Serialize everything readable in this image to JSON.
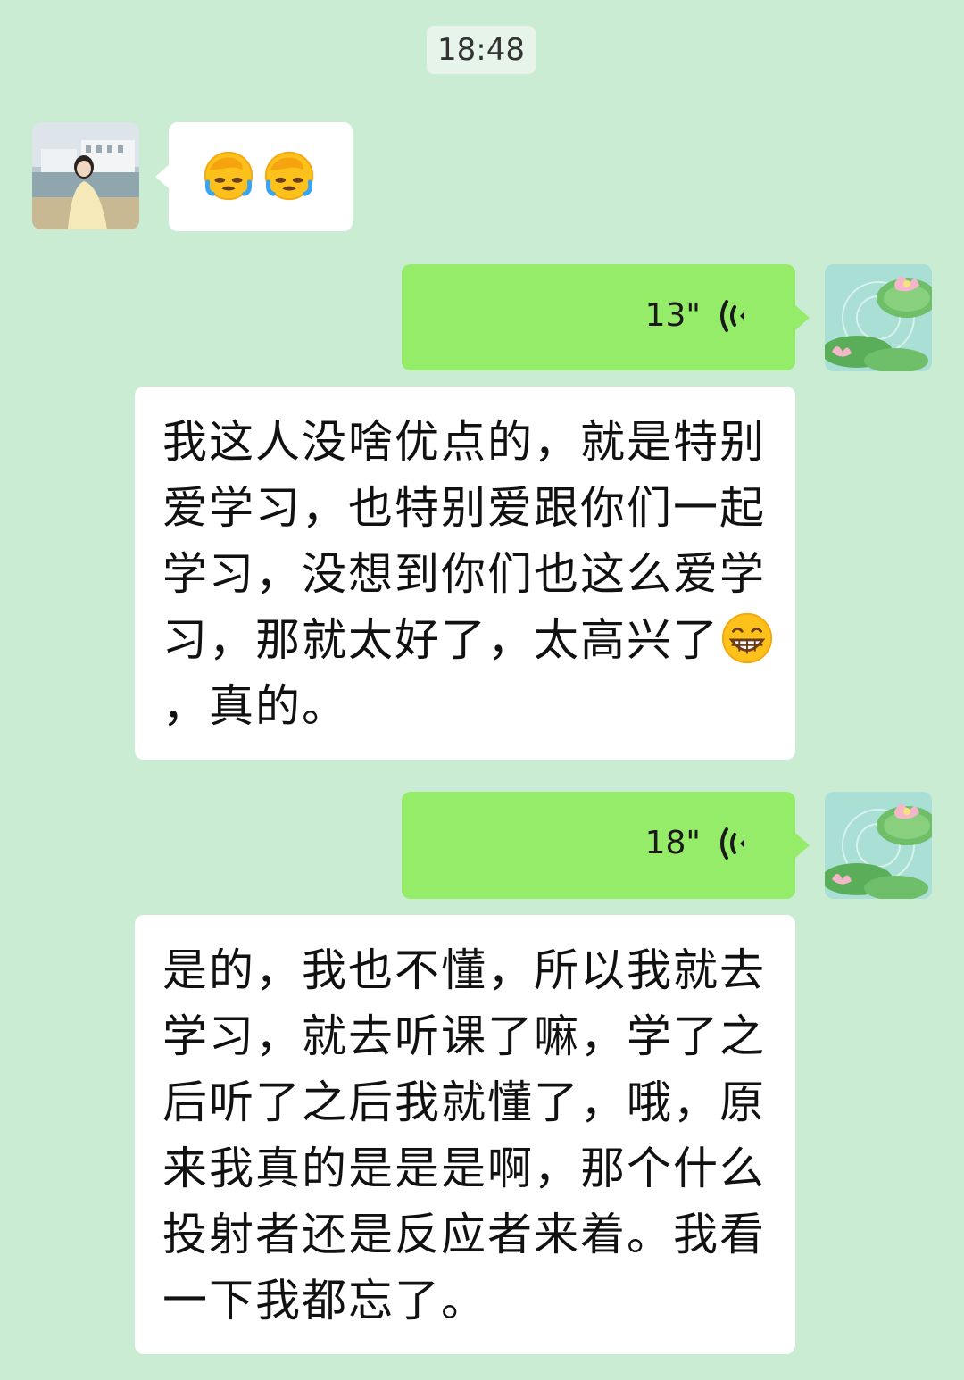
{
  "chat": {
    "timestamp": "18:48",
    "messages": [
      {
        "sender": "other",
        "type": "emoji",
        "emoji": [
          "face-palm-crying-emoji",
          "face-palm-crying-emoji"
        ]
      },
      {
        "sender": "self",
        "type": "voice",
        "duration": "13\""
      },
      {
        "sender": "self",
        "type": "text",
        "text_before": "我这人没啥优点的，就是特别爱学习，也特别爱跟你们一起学习，没想到你们也这么爱学习，那就太好了，太高兴了",
        "emoji": "grin-emoji",
        "text_after": "，真的。"
      },
      {
        "sender": "self",
        "type": "voice",
        "duration": "18\""
      },
      {
        "sender": "self",
        "type": "text",
        "text": "是的，我也不懂，所以我就去学习，就去听课了嘛，学了之后听了之后我就懂了，哦，原来我真的是是是啊，那个什么投射者还是反应者来着。我看一下我都忘了。"
      }
    ]
  },
  "colors": {
    "background": "#c9ecd3",
    "self_bubble": "#95ec69",
    "other_bubble": "#ffffff",
    "timestamp_bg": "#e6f4ea"
  }
}
